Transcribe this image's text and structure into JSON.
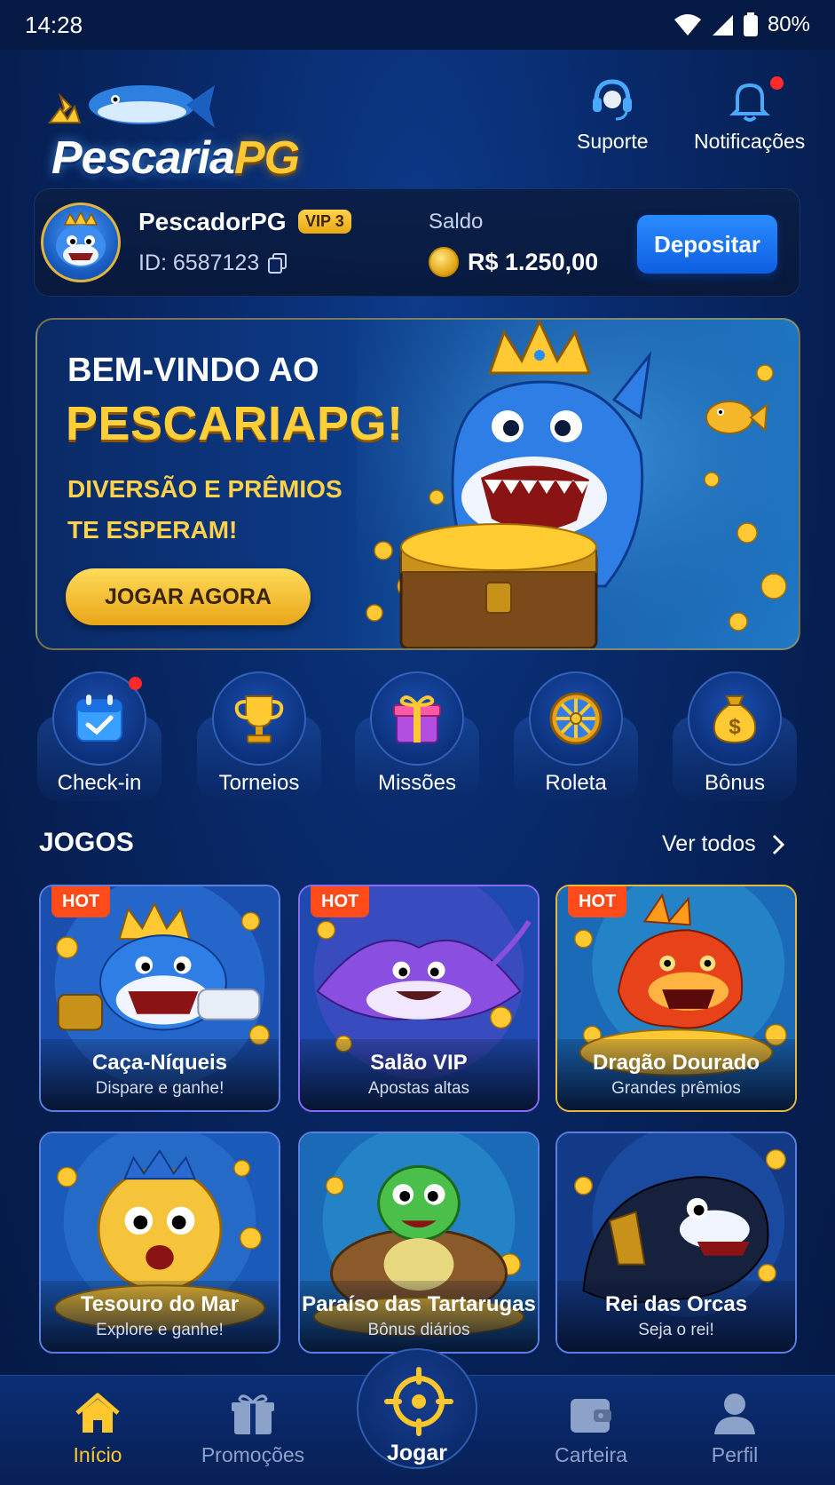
{
  "status": {
    "time": "14:28",
    "battery": "80%"
  },
  "header": {
    "logo_white": "Pescaria",
    "logo_gold": "PG",
    "support_label": "Suporte",
    "notifications_label": "Notificações"
  },
  "user": {
    "name": "PescadorPG",
    "vip": "VIP 3",
    "id": "ID: 6587123",
    "balance_label": "Saldo",
    "balance": "R$ 1.250,00",
    "deposit_label": "Depositar"
  },
  "banner": {
    "line1": "BEM-VINDO AO",
    "line2": "PESCARIAPG!",
    "line3": "DIVERSÃO E PRÊMIOS TE ESPERAM!",
    "cta": "JOGAR AGORA"
  },
  "shortcuts": [
    {
      "label": "Check-in",
      "icon": "calendar-check-icon"
    },
    {
      "label": "Torneios",
      "icon": "trophy-icon"
    },
    {
      "label": "Missões",
      "icon": "gift-icon"
    },
    {
      "label": "Roleta",
      "icon": "roulette-wheel-icon"
    },
    {
      "label": "Bônus",
      "icon": "money-bag-icon"
    }
  ],
  "games_section": {
    "title": "JOGOS",
    "see_all": "Ver todos"
  },
  "games": [
    {
      "title": "Caça-Níqueis",
      "subtitle": "Dispare e ganhe!",
      "badge": "HOT"
    },
    {
      "title": "Salão VIP",
      "subtitle": "Apostas altas",
      "badge": "HOT"
    },
    {
      "title": "Dragão Dourado",
      "subtitle": "Grandes prêmios",
      "badge": "HOT"
    },
    {
      "title": "Tesouro do Mar",
      "subtitle": "Explore e ganhe!"
    },
    {
      "title": "Paraíso das Tartarugas",
      "subtitle": "Bônus diários"
    },
    {
      "title": "Rei das Orcas",
      "subtitle": "Seja o rei!"
    }
  ],
  "nav": {
    "home": "Início",
    "promotions": "Promoções",
    "play": "Jogar",
    "wallet": "Carteira",
    "profile": "Perfil"
  },
  "colors": {
    "accent": "#ffc72c",
    "primary": "#0e5fe0",
    "hot": "#ff4a1a"
  }
}
